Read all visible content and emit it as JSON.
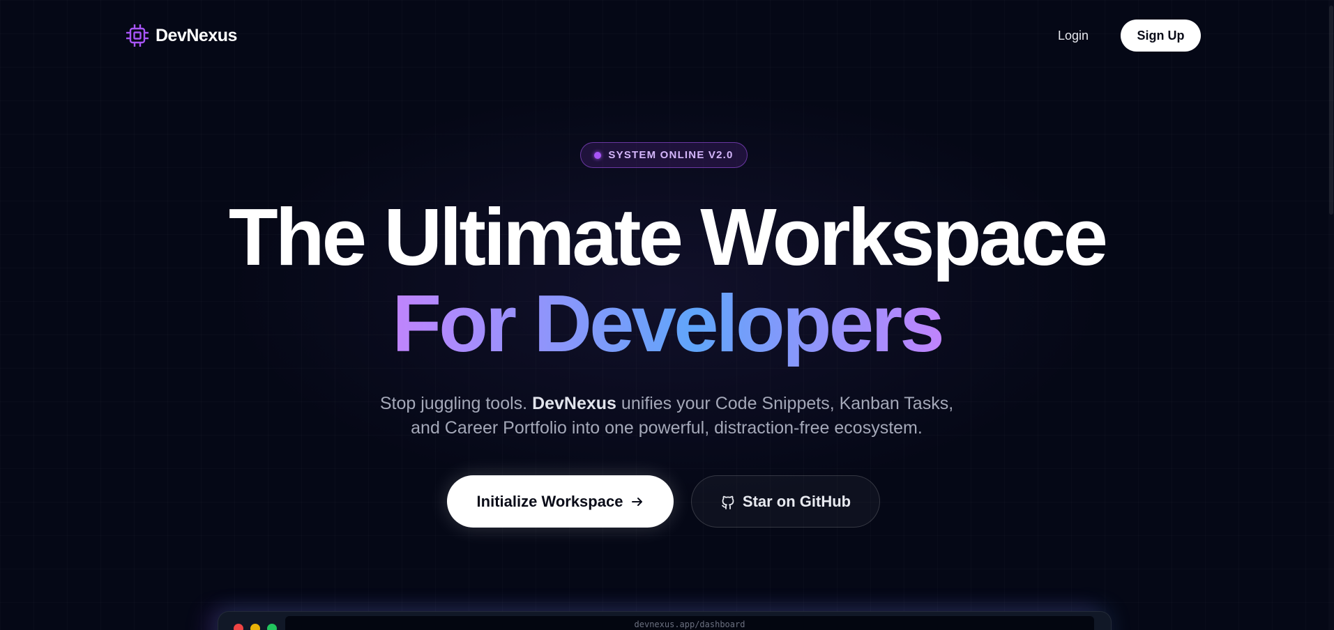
{
  "nav": {
    "brand": "DevNexus",
    "login_label": "Login",
    "signup_label": "Sign Up"
  },
  "badge": {
    "text": "SYSTEM ONLINE V2.0"
  },
  "hero": {
    "headline_line1": "The Ultimate Workspace",
    "headline_line2": "For Developers",
    "sub_part1": "Stop juggling tools. ",
    "sub_brand": "DevNexus",
    "sub_part2": " unifies your Code Snippets, Kanban Tasks,",
    "sub_line2": "and Career Portfolio into one powerful, distraction-free ecosystem."
  },
  "cta": {
    "primary_label": "Initialize Workspace",
    "secondary_label": "Star on GitHub"
  },
  "preview": {
    "url": "devnexus.app/dashboard"
  },
  "colors": {
    "background": "#050816",
    "accent_purple": "#a855f7",
    "gradient_start": "#c084fc",
    "gradient_mid": "#60a5fa"
  },
  "icons": {
    "logo": "cpu-chip-icon",
    "primary_cta": "arrow-right-icon",
    "secondary_cta": "github-icon"
  }
}
